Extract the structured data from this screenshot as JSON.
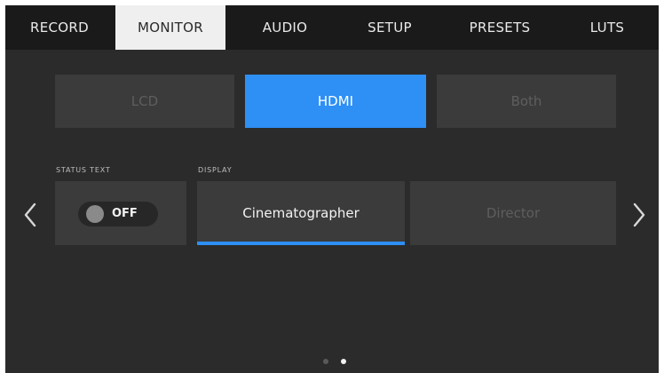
{
  "tabs": [
    {
      "label": "RECORD",
      "active": false
    },
    {
      "label": "MONITOR",
      "active": true
    },
    {
      "label": "AUDIO",
      "active": false
    },
    {
      "label": "SETUP",
      "active": false
    },
    {
      "label": "PRESETS",
      "active": false
    },
    {
      "label": "LUTS",
      "active": false
    }
  ],
  "monitor_select": {
    "options": [
      {
        "label": "LCD",
        "selected": false
      },
      {
        "label": "HDMI",
        "selected": true
      },
      {
        "label": "Both",
        "selected": false
      }
    ]
  },
  "status_text": {
    "caption": "STATUS TEXT",
    "toggle_value": "OFF"
  },
  "display": {
    "caption": "DISPLAY",
    "options": [
      {
        "label": "Cinematographer",
        "selected": true
      },
      {
        "label": "Director",
        "selected": false
      }
    ]
  },
  "pagination": {
    "total": 2,
    "current": 2
  },
  "colors": {
    "accent": "#2e8ff5",
    "background": "#2b2b2b",
    "tabbar": "#1a1a1a",
    "active_tab": "#efefef"
  },
  "icons": {
    "prev": "chevron-left-icon",
    "next": "chevron-right-icon"
  }
}
